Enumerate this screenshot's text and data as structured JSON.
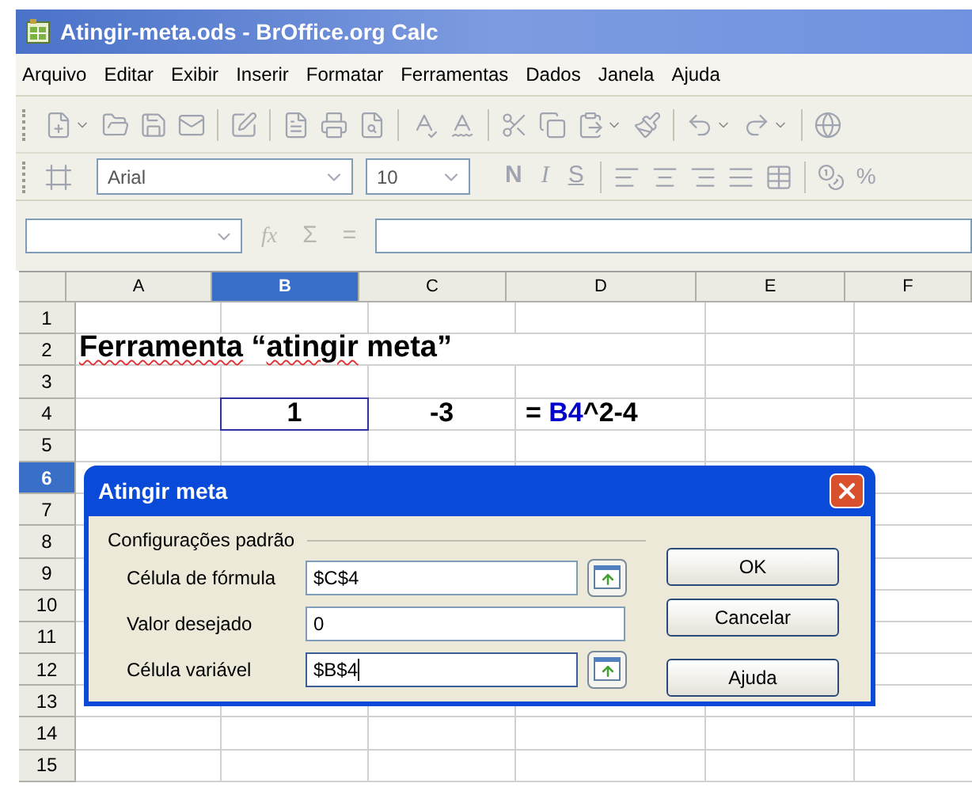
{
  "window": {
    "title": "Atingir-meta.ods - BrOffice.org Calc"
  },
  "menu": [
    "Arquivo",
    "Editar",
    "Exibir",
    "Inserir",
    "Formatar",
    "Ferramentas",
    "Dados",
    "Janela",
    "Ajuda"
  ],
  "format_toolbar": {
    "font": "Arial",
    "size": "10",
    "style_buttons": [
      "N",
      "I",
      "S"
    ],
    "percent": "%"
  },
  "formula_bar": {
    "buttons": [
      "fx",
      "Σ",
      "="
    ]
  },
  "columns": [
    {
      "label": "A",
      "selected": false
    },
    {
      "label": "B",
      "selected": true
    },
    {
      "label": "C",
      "selected": false
    },
    {
      "label": "D",
      "selected": false
    },
    {
      "label": "E",
      "selected": false
    },
    {
      "label": "F",
      "selected": false
    }
  ],
  "rows": [
    {
      "label": "1",
      "selected": false
    },
    {
      "label": "2",
      "selected": false
    },
    {
      "label": "3",
      "selected": false
    },
    {
      "label": "4",
      "selected": false
    },
    {
      "label": "5",
      "selected": false
    },
    {
      "label": "6",
      "selected": true
    },
    {
      "label": "7",
      "selected": false
    },
    {
      "label": "8",
      "selected": false
    },
    {
      "label": "9",
      "selected": false
    },
    {
      "label": "10",
      "selected": false
    },
    {
      "label": "11",
      "selected": false
    },
    {
      "label": "12",
      "selected": false
    },
    {
      "label": "13",
      "selected": false
    },
    {
      "label": "14",
      "selected": false
    },
    {
      "label": "15",
      "selected": false
    }
  ],
  "cells": {
    "heading": [
      {
        "text": "Ferramenta",
        "misspelled": true
      },
      {
        "text": " “",
        "misspelled": false
      },
      {
        "text": "atingir",
        "misspelled": true
      },
      {
        "text": " meta”",
        "misspelled": false
      }
    ],
    "b4": "1",
    "c4": "-3",
    "d4": [
      {
        "text": "= ",
        "color": "#000000"
      },
      {
        "text": "B4",
        "color": "#0000cc"
      },
      {
        "text": "^2-4",
        "color": "#000000"
      }
    ]
  },
  "dialog": {
    "title": "Atingir meta",
    "group": "Configurações padrão",
    "fields": [
      {
        "label": "Célula de fórmula",
        "value": "$C$4",
        "kind": "reference",
        "focused": false
      },
      {
        "label": "Valor desejado",
        "value": "0",
        "kind": "plain",
        "focused": false
      },
      {
        "label": "Célula variável",
        "value": "$B$4",
        "kind": "reference",
        "focused": true
      }
    ],
    "buttons": [
      "OK",
      "Cancelar",
      "Ajuda"
    ]
  }
}
